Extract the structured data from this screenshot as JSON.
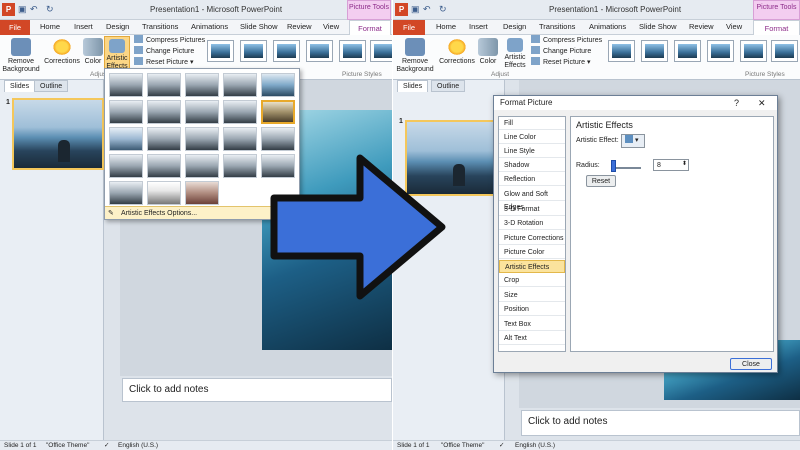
{
  "window_title": "Presentation1 - Microsoft PowerPoint",
  "picture_tools_label": "Picture Tools",
  "tabs": [
    "File",
    "Home",
    "Insert",
    "Design",
    "Transitions",
    "Animations",
    "Slide Show",
    "Review",
    "View",
    "Format"
  ],
  "ribbon": {
    "remove_background": "Remove Background",
    "corrections": "Corrections",
    "color": "Color",
    "artistic_effects": "Artistic Effects",
    "compress_pictures": "Compress Pictures",
    "change_picture": "Change Picture",
    "reset_picture": "Reset Picture",
    "adjust_group": "Adjust",
    "picture_styles_group": "Picture Styles"
  },
  "side_tabs": [
    "Slides",
    "Outline"
  ],
  "slide_number": "1",
  "gallery": {
    "options_label": "Artistic Effects Options..."
  },
  "notes_placeholder": "Click to add notes",
  "status": {
    "slide": "Slide 1 of 1",
    "theme": "\"Office Theme\"",
    "language": "English (U.S.)"
  },
  "dialog": {
    "title": "Format Picture",
    "help": "?",
    "close_x": "✕",
    "categories": [
      "Fill",
      "Line Color",
      "Line Style",
      "Shadow",
      "Reflection",
      "Glow and Soft Edges",
      "3-D Format",
      "3-D Rotation",
      "Picture Corrections",
      "Picture Color",
      "Artistic Effects",
      "Crop",
      "Size",
      "Position",
      "Text Box",
      "Alt Text"
    ],
    "selected_category": "Artistic Effects",
    "heading": "Artistic Effects",
    "effect_label": "Artistic Effect:",
    "radius_label": "Radius:",
    "radius_value": "8",
    "reset_label": "Reset",
    "close_label": "Close"
  },
  "colors": {
    "file_tab": "#d24726",
    "picture_tools": "#f3cdf0",
    "arrow": "#3b6fd8",
    "selection": "#fbe39d"
  }
}
